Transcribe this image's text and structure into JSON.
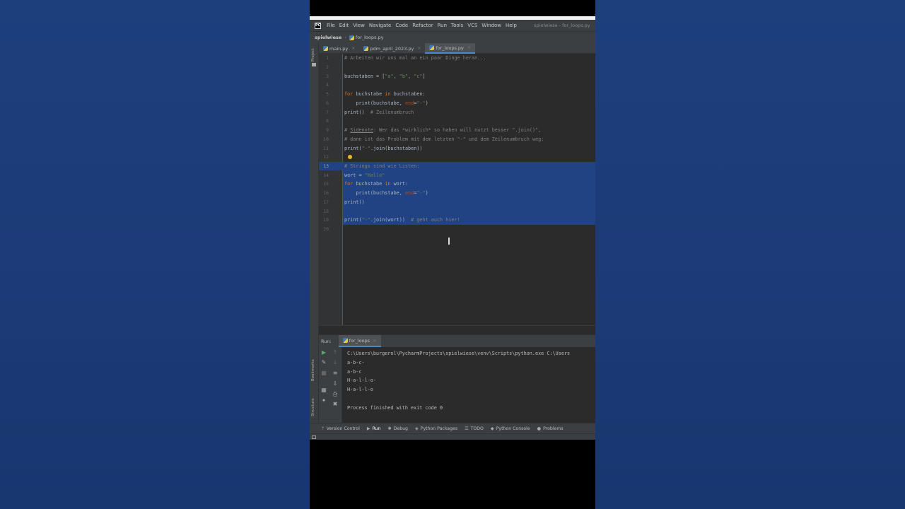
{
  "window": {
    "title": "spielwiese - for_loops.py",
    "logo_text": "PC"
  },
  "menu": [
    "File",
    "Edit",
    "View",
    "Navigate",
    "Code",
    "Refactor",
    "Run",
    "Tools",
    "VCS",
    "Window",
    "Help"
  ],
  "breadcrumb": {
    "project": "spielwiese",
    "file": "for_loops.py"
  },
  "side_tools": {
    "project": "Project",
    "bookmarks": "Bookmarks",
    "structure": "Structure"
  },
  "tabs": [
    {
      "label": "main.py",
      "active": false
    },
    {
      "label": "pdm_april_2023.py",
      "active": false
    },
    {
      "label": "for_loops.py",
      "active": true
    }
  ],
  "editor": {
    "line_numbers": [
      "1",
      "2",
      "3",
      "4",
      "5",
      "6",
      "7",
      "8",
      "9",
      "10",
      "11",
      "12",
      "13",
      "14",
      "15",
      "16",
      "17",
      "18",
      "19",
      "20"
    ],
    "selected_lines": "13-19",
    "caret_line": 13
  },
  "run": {
    "label": "Run:",
    "tab": "for_loops",
    "output": [
      "C:\\Users\\burgerol\\PycharmProjects\\spielwiese\\venv\\Scripts\\python.exe C:\\Users",
      "a-b-c-",
      "a-b-c",
      "H-a-l-l-o-",
      "H-a-l-l-o",
      "",
      "Process finished with exit code 0"
    ]
  },
  "status_bar": [
    {
      "label": "Version Control",
      "icon": "branch-icon"
    },
    {
      "label": "Run",
      "icon": "play-icon",
      "active": true
    },
    {
      "label": "Debug",
      "icon": "bug-icon"
    },
    {
      "label": "Python Packages",
      "icon": "packages-icon"
    },
    {
      "label": "TODO",
      "icon": "list-icon"
    },
    {
      "label": "Python Console",
      "icon": "console-icon"
    },
    {
      "label": "Problems",
      "icon": "info-icon"
    }
  ],
  "colors": {
    "keyword": "#cc7832",
    "string": "#6a8759",
    "comment": "#808080",
    "selection": "#214283",
    "background": "#2b2b2b"
  }
}
